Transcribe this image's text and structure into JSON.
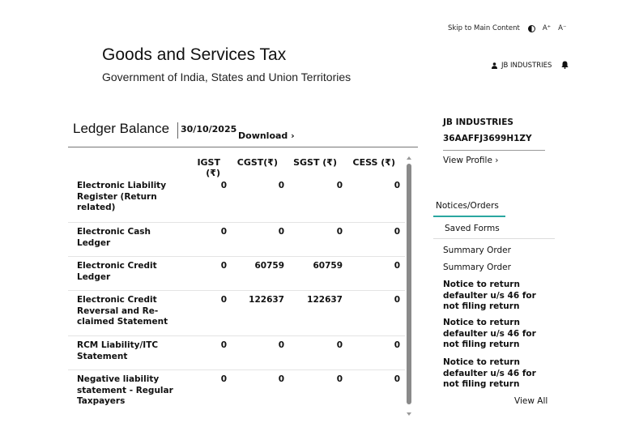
{
  "utility": {
    "skip_link": "Skip to Main Content",
    "font_increase": "A⁺",
    "font_decrease": "A⁻"
  },
  "header": {
    "title": "Goods and Services Tax",
    "subtitle": "Government of India, States and Union Territories",
    "user_name": "JB INDUSTRIES"
  },
  "ledger": {
    "title": "Ledger Balance",
    "date": "30/10/2025",
    "download_label": "Download ›",
    "columns": [
      "IGST (₹)",
      "CGST(₹)",
      "SGST (₹)",
      "CESS (₹)"
    ],
    "rows": [
      {
        "label": "Electronic Liability Register (Return related)",
        "values": [
          "0",
          "0",
          "0",
          "0"
        ]
      },
      {
        "label": "Electronic Cash Ledger",
        "values": [
          "0",
          "0",
          "0",
          "0"
        ]
      },
      {
        "label": "Electronic Credit Ledger",
        "values": [
          "0",
          "60759",
          "60759",
          "0"
        ]
      },
      {
        "label": "Electronic Credit Reversal and Re-claimed Statement",
        "values": [
          "0",
          "122637",
          "122637",
          "0"
        ]
      },
      {
        "label": "RCM Liability/ITC Statement",
        "values": [
          "0",
          "0",
          "0",
          "0"
        ]
      },
      {
        "label": "Negative liability statement - Regular Taxpayers",
        "values": [
          "0",
          "0",
          "0",
          "0"
        ]
      }
    ]
  },
  "profile": {
    "name": "JB INDUSTRIES",
    "gstin": "36AAFFJ3699H1ZY",
    "view_profile": "View Profile ›"
  },
  "tabs": {
    "notices": "Notices/Orders",
    "saved": "Saved Forms"
  },
  "notices": [
    {
      "text": "Summary Order",
      "bold": false
    },
    {
      "text": "Summary Order",
      "bold": false
    },
    {
      "text": "Notice to return defaulter u/s 46 for not filing return",
      "bold": true
    },
    {
      "text": "Notice to return defaulter u/s 46 for not filing return",
      "bold": true
    },
    {
      "text": "Notice to return defaulter u/s 46 for not filing return",
      "bold": true
    }
  ],
  "view_all": "View All",
  "colors": {
    "accent": "#2aa7a0",
    "scrollbar": "#8a8a8a"
  }
}
